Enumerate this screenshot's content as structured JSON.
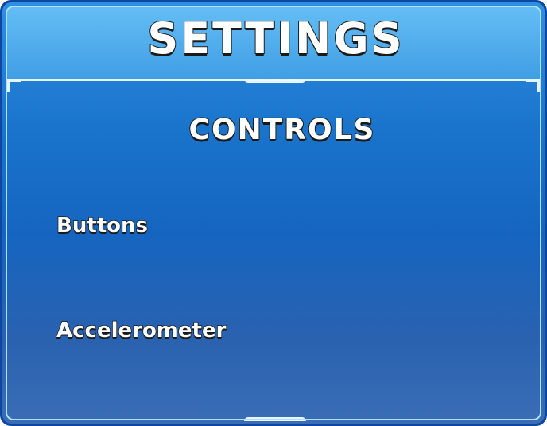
{
  "screen": {
    "title": "SETTINGS",
    "section_title": "CONTROLS",
    "options": [
      {
        "label": "Buttons"
      },
      {
        "label": "Accelerometer"
      }
    ]
  },
  "colors": {
    "panel_top": "#2f8fe0",
    "panel_bottom": "#3a6db5",
    "header": "#64bdf5",
    "border": "#0d47a1",
    "text": "#ffffff",
    "text_outline": "#1b1b1b"
  }
}
